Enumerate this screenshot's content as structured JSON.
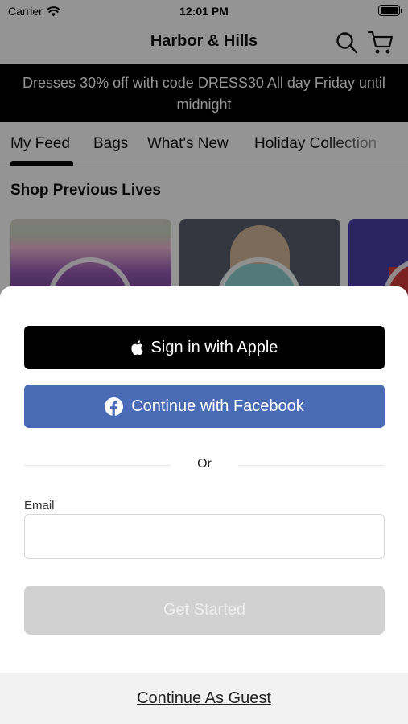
{
  "status_bar": {
    "carrier": "Carrier",
    "time": "12:01 PM"
  },
  "nav": {
    "title": "Harbor & Hills",
    "search_icon": "search-icon",
    "cart_icon": "cart-icon"
  },
  "promo": {
    "text": "Dresses 30% off with code DRESS30 All day Friday until midnight"
  },
  "tabs": [
    {
      "label": "My Feed",
      "active": true
    },
    {
      "label": "Bags",
      "active": false
    },
    {
      "label": "What's New",
      "active": false
    },
    {
      "label": "Holiday Collection",
      "active": false
    }
  ],
  "section": {
    "title": "Shop Previous Lives"
  },
  "sheet": {
    "apple_button": "Sign in with Apple",
    "facebook_button": "Continue with Facebook",
    "divider_text": "Or",
    "email_label": "Email",
    "email_value": "",
    "email_placeholder": "",
    "get_started_button": "Get Started",
    "guest_link": "Continue As Guest"
  },
  "colors": {
    "facebook": "#4a6bb5",
    "apple": "#000000",
    "disabled_button": "#d1d1d1",
    "promo_background": "#000000"
  }
}
